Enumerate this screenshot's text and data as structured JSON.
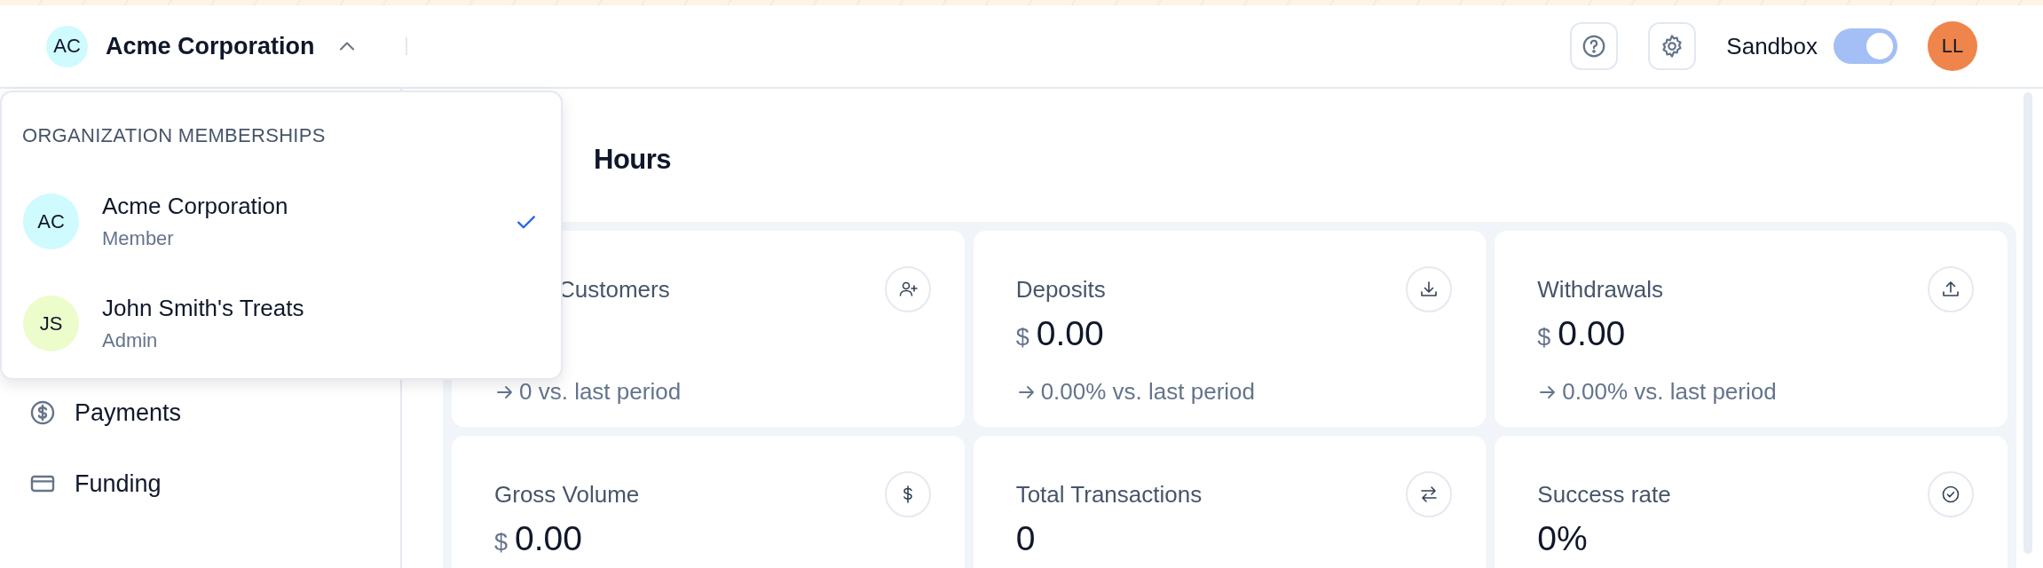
{
  "header": {
    "organization": {
      "initials": "AC",
      "name": "Acme Corporation",
      "expanded": true
    },
    "sandbox": {
      "label": "Sandbox",
      "on": true
    },
    "user": {
      "initials": "LL"
    }
  },
  "sidebar": {
    "items": [
      {
        "label": "Payments",
        "kind": "dollar"
      },
      {
        "label": "Funding",
        "kind": "card"
      }
    ]
  },
  "org_menu": {
    "heading": "ORGANIZATION MEMBERSHIPS",
    "items": [
      {
        "initials": "AC",
        "name": "Acme Corporation",
        "role": "Member",
        "color": "#cffafe",
        "selected": true
      },
      {
        "initials": "JS",
        "name": "John Smith's Treats",
        "role": "Admin",
        "color": "#ecfccb",
        "selected": false
      }
    ]
  },
  "main": {
    "title": "Hours",
    "cards": [
      {
        "label": "Customers",
        "kind": "customers",
        "change": "0 vs. last period"
      },
      {
        "label": "Deposits",
        "kind": "deposits",
        "currency": "$",
        "value": "0.00",
        "change": "0.00% vs. last period"
      },
      {
        "label": "Withdrawals",
        "kind": "withdrawals",
        "currency": "$",
        "value": "0.00",
        "change": "0.00% vs. last period"
      },
      {
        "label": "Gross Volume",
        "kind": "volume",
        "currency": "$",
        "value": "0.00"
      },
      {
        "label": "Total Transactions",
        "kind": "transactions",
        "value": "0"
      },
      {
        "label": "Success rate",
        "kind": "rate",
        "value": "0%"
      }
    ]
  }
}
